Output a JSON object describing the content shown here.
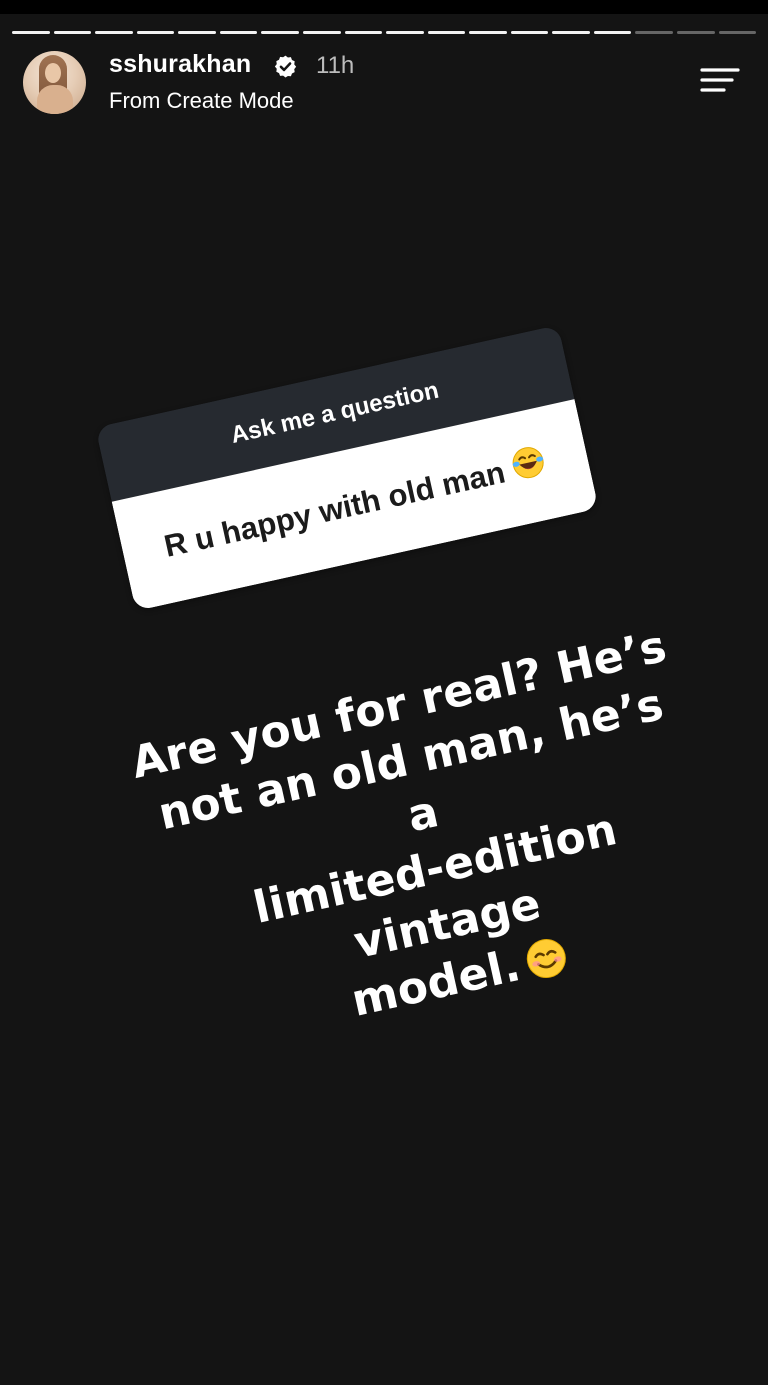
{
  "progress": {
    "total_segments": 18,
    "completed_segments": 15
  },
  "header": {
    "username": "sshurakhan",
    "time": "11h",
    "subtitle": "From Create Mode"
  },
  "sticker": {
    "prompt": "Ask me a question",
    "question": "R u happy with old man",
    "question_emoji": "laughing-tears-emoji"
  },
  "reply": {
    "line1": "Are you for real? He’s",
    "line2": "not an old man, he’s a",
    "line3": "limited-edition vintage",
    "line4": "model.",
    "emoji": "smiling-face-emoji"
  },
  "colors": {
    "background": "#141414",
    "sticker_header": "#262a30",
    "verified_badge": "#ffffff"
  }
}
